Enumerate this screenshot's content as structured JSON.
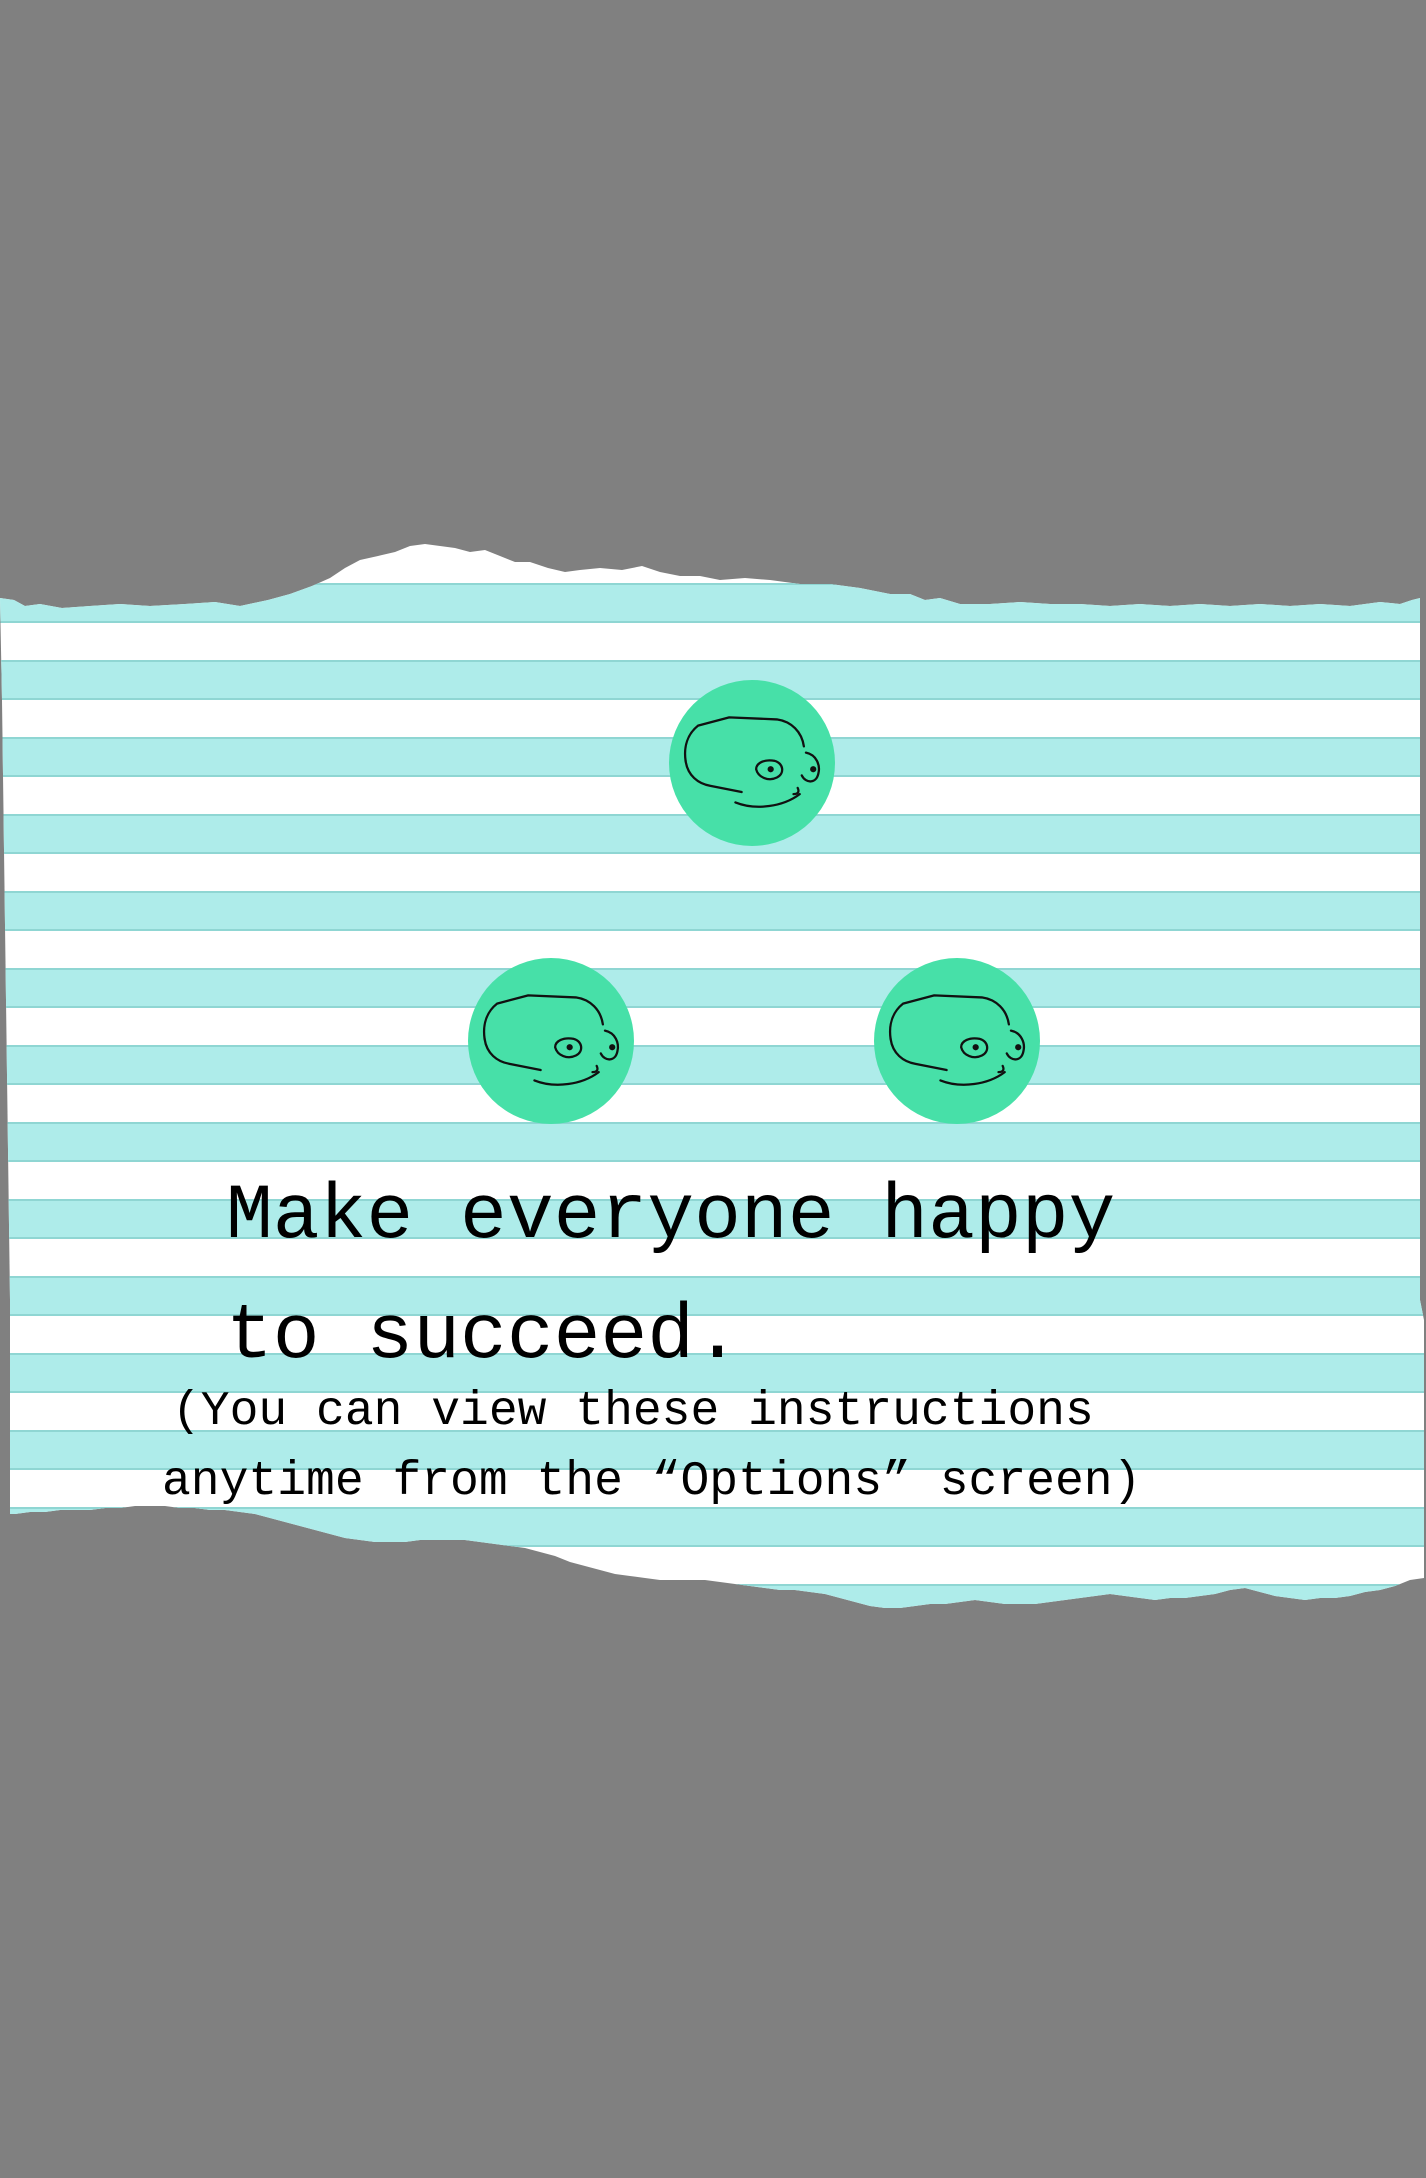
{
  "instructions": {
    "headline_line1": "Make everyone happy",
    "headline_line2": "to succeed.",
    "note_line1": "(You can view these instructions",
    "note_line2": "anytime from the “Options” screen)"
  },
  "faces": [
    {
      "icon": "happy-face-icon",
      "color": "#47e0a8"
    },
    {
      "icon": "happy-face-icon",
      "color": "#47e0a8"
    },
    {
      "icon": "happy-face-icon",
      "color": "#47e0a8"
    }
  ],
  "colors": {
    "background": "#808080",
    "paper": "#ffffff",
    "stripe": "#aeecea",
    "stripe_edge": "#8fd6d3",
    "face": "#47e0a8",
    "text": "#000000"
  }
}
